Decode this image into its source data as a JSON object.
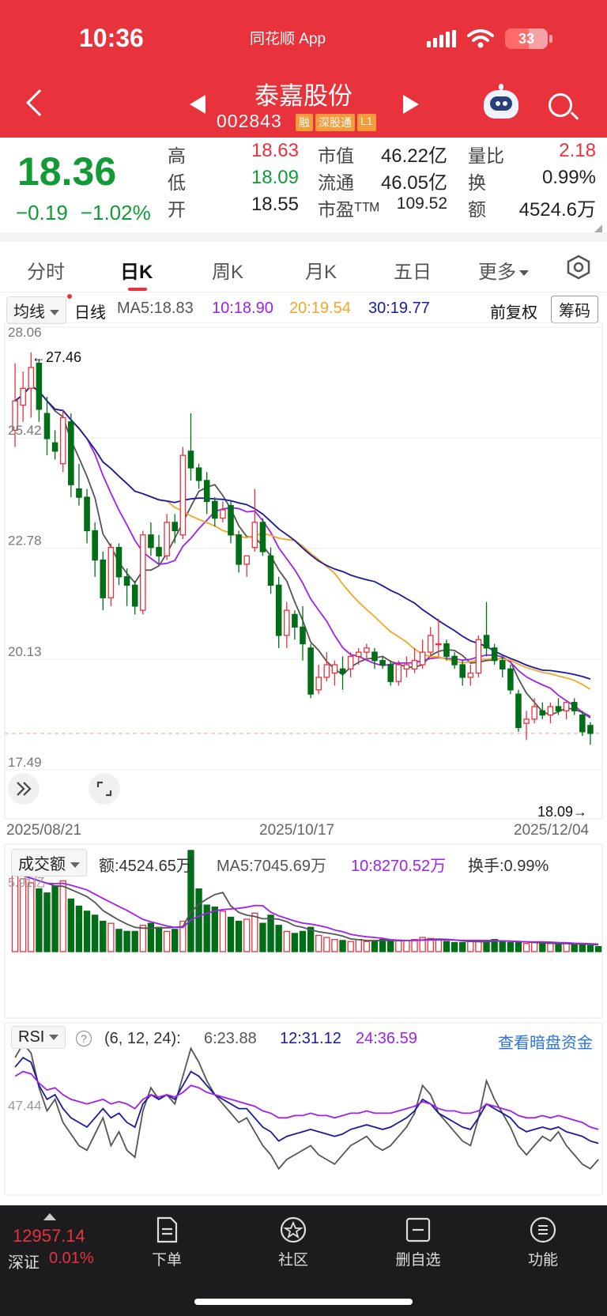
{
  "status": {
    "time": "10:36",
    "app_label": "同花顺 App",
    "battery": "33"
  },
  "header": {
    "stock_name": "泰嘉股份",
    "stock_code": "002843",
    "tags": [
      "融",
      "深股通",
      "L1"
    ]
  },
  "quote": {
    "price": "18.36",
    "change": "−0.19",
    "change_pct": "−1.02%",
    "high_label": "高",
    "high": "18.63",
    "low_label": "低",
    "low": "18.09",
    "open_label": "开",
    "open": "18.55",
    "mktcap_label": "市值",
    "mktcap": "46.22亿",
    "float_label": "流通",
    "float": "46.05亿",
    "pe_label": "市盈ᵀᵀᴹ",
    "pe": "109.52",
    "volratio_label": "量比",
    "volratio": "2.18",
    "turnover_label": "换",
    "turnover": "0.99%",
    "amount_label": "额",
    "amount": "4524.6万"
  },
  "tabs": [
    "分时",
    "日K",
    "周K",
    "月K",
    "五日",
    "更多"
  ],
  "active_tab": "日K",
  "ma_bar": {
    "dropdown": "均线",
    "period": "日线",
    "ma5": "MA5:18.83",
    "ma10": "10:18.90",
    "ma20": "20:19.54",
    "ma30": "30:19.77",
    "adjust_btn": "前复权",
    "chips_btn": "筹码"
  },
  "colors": {
    "up": "#e8323c",
    "down": "#006e17",
    "ma5": "#555555",
    "ma10": "#a020f0",
    "ma20": "#f5a623",
    "ma30": "#1a1a9e"
  },
  "chart_data": [
    {
      "type": "candlestick",
      "title": "日K",
      "ylim": [
        17.49,
        28.06
      ],
      "y_ticks": [
        "28.06",
        "25.42",
        "22.78",
        "20.13",
        "17.49"
      ],
      "x_labels": [
        "2025/08/21",
        "2025/10/17",
        "2025/12/04"
      ],
      "annotations": [
        "←27.46",
        "18.09→"
      ],
      "candles": [
        {
          "o": 25.6,
          "h": 27.2,
          "l": 25.2,
          "c": 26.3
        },
        {
          "o": 26.2,
          "h": 27.0,
          "l": 25.8,
          "c": 26.6
        },
        {
          "o": 26.6,
          "h": 27.46,
          "l": 25.9,
          "c": 27.1
        },
        {
          "o": 27.2,
          "h": 27.3,
          "l": 25.8,
          "c": 26.1
        },
        {
          "o": 26.0,
          "h": 26.4,
          "l": 25.0,
          "c": 25.4
        },
        {
          "o": 25.3,
          "h": 25.6,
          "l": 24.9,
          "c": 25.1
        },
        {
          "o": 24.8,
          "h": 26.1,
          "l": 24.6,
          "c": 25.9
        },
        {
          "o": 25.8,
          "h": 26.0,
          "l": 24.0,
          "c": 24.3
        },
        {
          "o": 24.2,
          "h": 24.8,
          "l": 23.8,
          "c": 24.0
        },
        {
          "o": 24.0,
          "h": 24.2,
          "l": 22.9,
          "c": 23.2
        },
        {
          "o": 23.2,
          "h": 23.4,
          "l": 22.1,
          "c": 22.5
        },
        {
          "o": 22.5,
          "h": 22.7,
          "l": 21.3,
          "c": 21.6
        },
        {
          "o": 21.6,
          "h": 22.9,
          "l": 21.4,
          "c": 22.8
        },
        {
          "o": 22.8,
          "h": 22.9,
          "l": 21.9,
          "c": 22.1
        },
        {
          "o": 22.1,
          "h": 22.3,
          "l": 21.4,
          "c": 21.9
        },
        {
          "o": 21.9,
          "h": 22.0,
          "l": 21.2,
          "c": 21.4
        },
        {
          "o": 21.3,
          "h": 23.2,
          "l": 21.2,
          "c": 23.1
        },
        {
          "o": 23.1,
          "h": 23.4,
          "l": 22.6,
          "c": 22.8
        },
        {
          "o": 22.8,
          "h": 23.1,
          "l": 22.4,
          "c": 22.6
        },
        {
          "o": 22.6,
          "h": 23.6,
          "l": 22.5,
          "c": 23.4
        },
        {
          "o": 23.4,
          "h": 23.6,
          "l": 22.9,
          "c": 23.2
        },
        {
          "o": 23.1,
          "h": 25.2,
          "l": 23.0,
          "c": 25.0
        },
        {
          "o": 25.1,
          "h": 26.0,
          "l": 24.4,
          "c": 24.7
        },
        {
          "o": 24.7,
          "h": 24.8,
          "l": 24.2,
          "c": 24.4
        },
        {
          "o": 24.4,
          "h": 24.6,
          "l": 23.6,
          "c": 23.9
        },
        {
          "o": 23.9,
          "h": 24.0,
          "l": 23.3,
          "c": 23.5
        },
        {
          "o": 23.5,
          "h": 23.9,
          "l": 23.4,
          "c": 23.7
        },
        {
          "o": 23.8,
          "h": 23.9,
          "l": 22.9,
          "c": 23.1
        },
        {
          "o": 23.1,
          "h": 23.2,
          "l": 22.2,
          "c": 22.4
        },
        {
          "o": 22.4,
          "h": 22.6,
          "l": 22.1,
          "c": 22.6
        },
        {
          "o": 22.8,
          "h": 24.2,
          "l": 22.7,
          "c": 23.4
        },
        {
          "o": 23.4,
          "h": 23.5,
          "l": 22.6,
          "c": 22.7
        },
        {
          "o": 22.6,
          "h": 22.8,
          "l": 21.7,
          "c": 21.9
        },
        {
          "o": 21.9,
          "h": 22.1,
          "l": 20.4,
          "c": 20.7
        },
        {
          "o": 20.7,
          "h": 21.5,
          "l": 20.4,
          "c": 21.3
        },
        {
          "o": 21.2,
          "h": 21.3,
          "l": 20.6,
          "c": 20.9
        },
        {
          "o": 20.9,
          "h": 21.4,
          "l": 20.1,
          "c": 20.5
        },
        {
          "o": 20.4,
          "h": 20.5,
          "l": 19.2,
          "c": 19.3
        },
        {
          "o": 19.4,
          "h": 20.0,
          "l": 19.3,
          "c": 19.7
        },
        {
          "o": 19.7,
          "h": 20.3,
          "l": 19.6,
          "c": 20.0
        },
        {
          "o": 19.8,
          "h": 20.1,
          "l": 19.5,
          "c": 20.0
        },
        {
          "o": 19.9,
          "h": 20.2,
          "l": 19.4,
          "c": 19.8
        },
        {
          "o": 19.9,
          "h": 20.3,
          "l": 19.7,
          "c": 20.2
        },
        {
          "o": 20.2,
          "h": 20.4,
          "l": 20.0,
          "c": 20.3
        },
        {
          "o": 20.3,
          "h": 20.5,
          "l": 20.1,
          "c": 20.4
        },
        {
          "o": 20.3,
          "h": 20.4,
          "l": 19.9,
          "c": 20.1
        },
        {
          "o": 20.1,
          "h": 20.2,
          "l": 19.9,
          "c": 20.0
        },
        {
          "o": 20.0,
          "h": 20.1,
          "l": 19.5,
          "c": 19.6
        },
        {
          "o": 19.6,
          "h": 20.1,
          "l": 19.5,
          "c": 20.0
        },
        {
          "o": 19.9,
          "h": 20.2,
          "l": 19.7,
          "c": 20.0
        },
        {
          "o": 19.9,
          "h": 20.4,
          "l": 19.8,
          "c": 20.1
        },
        {
          "o": 20.0,
          "h": 20.6,
          "l": 19.9,
          "c": 20.3
        },
        {
          "o": 20.3,
          "h": 20.9,
          "l": 20.2,
          "c": 20.7
        },
        {
          "o": 20.5,
          "h": 21.1,
          "l": 20.2,
          "c": 20.5
        },
        {
          "o": 20.5,
          "h": 20.6,
          "l": 20.1,
          "c": 20.2
        },
        {
          "o": 20.2,
          "h": 20.3,
          "l": 19.9,
          "c": 20.0
        },
        {
          "o": 20.0,
          "h": 20.1,
          "l": 19.5,
          "c": 19.7
        },
        {
          "o": 19.7,
          "h": 20.0,
          "l": 19.5,
          "c": 19.8
        },
        {
          "o": 19.8,
          "h": 20.7,
          "l": 19.7,
          "c": 20.6
        },
        {
          "o": 20.7,
          "h": 21.5,
          "l": 20.2,
          "c": 20.4
        },
        {
          "o": 20.4,
          "h": 20.5,
          "l": 20.0,
          "c": 20.1
        },
        {
          "o": 20.1,
          "h": 20.2,
          "l": 19.7,
          "c": 19.9
        },
        {
          "o": 19.9,
          "h": 20.0,
          "l": 19.3,
          "c": 19.4
        },
        {
          "o": 19.3,
          "h": 19.4,
          "l": 18.4,
          "c": 18.5
        },
        {
          "o": 18.6,
          "h": 18.9,
          "l": 18.2,
          "c": 18.7
        },
        {
          "o": 18.7,
          "h": 19.2,
          "l": 18.6,
          "c": 19.0
        },
        {
          "o": 18.9,
          "h": 19.1,
          "l": 18.7,
          "c": 18.8
        },
        {
          "o": 18.8,
          "h": 19.1,
          "l": 18.6,
          "c": 19.0
        },
        {
          "o": 19.0,
          "h": 19.2,
          "l": 18.8,
          "c": 18.9
        },
        {
          "o": 18.9,
          "h": 19.1,
          "l": 18.7,
          "c": 19.1
        },
        {
          "o": 19.1,
          "h": 19.2,
          "l": 18.8,
          "c": 18.9
        },
        {
          "o": 18.8,
          "h": 18.9,
          "l": 18.3,
          "c": 18.4
        },
        {
          "o": 18.55,
          "h": 18.63,
          "l": 18.09,
          "c": 18.36
        }
      ]
    },
    {
      "type": "bar",
      "title": "成交额",
      "y_ticks": [
        "5.91亿"
      ],
      "values": [
        78,
        72,
        68,
        62,
        58,
        65,
        70,
        52,
        45,
        40,
        36,
        30,
        28,
        22,
        20,
        20,
        26,
        28,
        24,
        20,
        22,
        30,
        100,
        62,
        46,
        44,
        40,
        34,
        30,
        32,
        38,
        28,
        36,
        26,
        20,
        18,
        20,
        24,
        16,
        14,
        12,
        11,
        10,
        12,
        10,
        11,
        12,
        10,
        11,
        11,
        12,
        14,
        13,
        12,
        10,
        9,
        9,
        10,
        11,
        10,
        12,
        10,
        9,
        9,
        8,
        9,
        8,
        8,
        7,
        8,
        7,
        8,
        6,
        5
      ]
    },
    {
      "type": "line",
      "title": "RSI",
      "ylim": [
        0,
        100
      ],
      "y_ticks": [
        "47.44"
      ],
      "series": [
        {
          "name": "6",
          "values": [
            68,
            74,
            70,
            55,
            45,
            50,
            40,
            35,
            30,
            28,
            35,
            42,
            30,
            36,
            28,
            25,
            45,
            55,
            50,
            52,
            48,
            60,
            72,
            66,
            58,
            52,
            48,
            44,
            40,
            42,
            36,
            30,
            26,
            20,
            24,
            26,
            28,
            30,
            26,
            24,
            22,
            26,
            30,
            32,
            34,
            30,
            28,
            30,
            34,
            38,
            44,
            56,
            52,
            44,
            40,
            36,
            32,
            30,
            42,
            58,
            50,
            44,
            38,
            30,
            26,
            30,
            34,
            32,
            36,
            30,
            26,
            22,
            20,
            24
          ]
        },
        {
          "name": "12",
          "values": [
            64,
            68,
            66,
            56,
            50,
            52,
            46,
            42,
            40,
            38,
            42,
            46,
            42,
            44,
            40,
            38,
            48,
            52,
            50,
            52,
            50,
            56,
            62,
            60,
            56,
            52,
            50,
            48,
            46,
            46,
            42,
            38,
            36,
            32,
            34,
            35,
            36,
            37,
            36,
            35,
            34,
            35,
            37,
            38,
            39,
            38,
            37,
            38,
            40,
            42,
            45,
            50,
            48,
            44,
            42,
            40,
            38,
            37,
            42,
            48,
            46,
            44,
            42,
            38,
            36,
            37,
            38,
            37,
            38,
            36,
            35,
            34,
            32,
            31
          ]
        },
        {
          "name": "24",
          "values": [
            60,
            62,
            61,
            57,
            54,
            55,
            52,
            50,
            49,
            48,
            49,
            50,
            48,
            49,
            48,
            46,
            50,
            52,
            51,
            52,
            51,
            53,
            56,
            55,
            53,
            52,
            51,
            50,
            49,
            48,
            47,
            45,
            44,
            42,
            42,
            43,
            43,
            44,
            43,
            43,
            42,
            43,
            44,
            44,
            45,
            44,
            44,
            44,
            45,
            46,
            47,
            49,
            48,
            46,
            45,
            45,
            44,
            44,
            45,
            48,
            47,
            46,
            45,
            43,
            42,
            42,
            43,
            42,
            43,
            42,
            41,
            40,
            38,
            37
          ]
        }
      ]
    }
  ],
  "vol_bar": {
    "dropdown": "成交额",
    "amount": "额:4524.65万",
    "ma5": "MA5:7045.69万",
    "ma10": "10:8270.52万",
    "turnover": "换手:0.99%"
  },
  "rsi_bar": {
    "dropdown": "RSI",
    "params": "(6, 12, 24):",
    "rsi6": "6:23.88",
    "rsi12": "12:31.12",
    "rsi24": "24:36.59",
    "link": "查看暗盘资金"
  },
  "bottom_nav": {
    "index_value": "12957.14",
    "index_name": "深证",
    "index_pct": "0.01%",
    "items": [
      "下单",
      "社区",
      "删自选",
      "功能"
    ]
  }
}
